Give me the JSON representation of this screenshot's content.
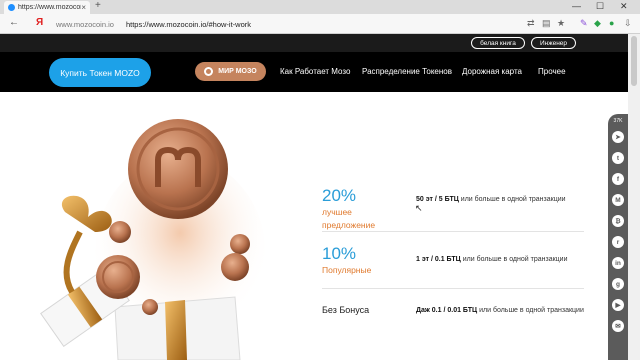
{
  "browser": {
    "tab_title": "https://www.mozocoin.io",
    "tab_close": "×",
    "new_tab": "+",
    "url_domain": "www.mozocoin.io",
    "url_full": "https://www.mozocoin.io/#how-it-work",
    "back": "←",
    "yandex": "Я",
    "window_min": "—",
    "window_max": "☐",
    "window_close": "✕"
  },
  "site_header": {
    "whitepaper": "белая книга",
    "engineer": "Инженер"
  },
  "nav": {
    "buy_button": "Купить Токен MOZO",
    "mir_mozo": "МИР МОЗО",
    "links": [
      "Как Работает Мозо",
      "Распределение Токенов",
      "Дорожная карта",
      "Прочее"
    ]
  },
  "offers": [
    {
      "percent": "20%",
      "sub_lines": [
        "лучшее",
        "предложение"
      ],
      "amount": "50 эт / 5 БТЦ",
      "rest": " или больше в одной транзакции"
    },
    {
      "percent": "10%",
      "sub_lines": [
        "Популярные"
      ],
      "amount": "1 эт / 0.1 БТЦ",
      "rest": " или больше в одной транзакции"
    },
    {
      "title": "Без Бонуса",
      "amount": "Даж 0.1 / 0.01 БТЦ",
      "rest": " или больше в одной транзакции"
    }
  ],
  "social": {
    "count": "37K",
    "icons": [
      {
        "name": "telegram-icon",
        "glyph": "➤"
      },
      {
        "name": "twitter-icon",
        "glyph": "t"
      },
      {
        "name": "facebook-icon",
        "glyph": "f"
      },
      {
        "name": "medium-icon",
        "glyph": "M"
      },
      {
        "name": "bitcoin-icon",
        "glyph": "₿"
      },
      {
        "name": "reddit-icon",
        "glyph": "r"
      },
      {
        "name": "linkedin-icon",
        "glyph": "in"
      },
      {
        "name": "github-icon",
        "glyph": "g"
      },
      {
        "name": "youtube-icon",
        "glyph": "▶"
      },
      {
        "name": "email-icon",
        "glyph": "✉"
      }
    ]
  },
  "colors": {
    "accent_blue": "#1da1e8",
    "bronze": "#c5845e",
    "offer_orange": "#e07a2e",
    "percent_blue": "#2a9dd8"
  }
}
